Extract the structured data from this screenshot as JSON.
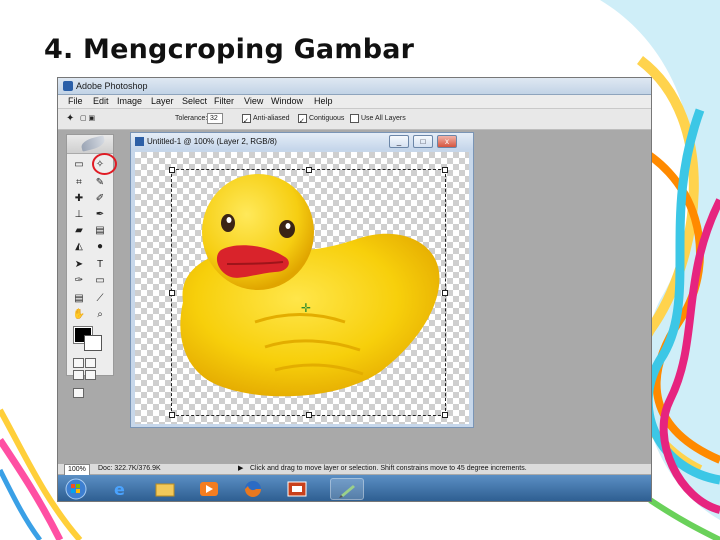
{
  "slide": {
    "title": "4. Mengcroping Gambar"
  },
  "window": {
    "app_title": "Adobe Photoshop"
  },
  "menu": [
    "File",
    "Edit",
    "Image",
    "Layer",
    "Select",
    "Filter",
    "View",
    "Window",
    "Help"
  ],
  "options_bar": {
    "tolerance_label": "Tolerance:",
    "tolerance_value": "32",
    "anti_aliased": "Anti-aliased",
    "contiguous": "Contiguous",
    "use_all_layers": "Use All Layers"
  },
  "document": {
    "title": "Untitled-1 @ 100% (Layer 2, RGB/8)",
    "buttons": [
      "_",
      "□",
      "x"
    ]
  },
  "status": {
    "zoom": "100%",
    "doc_size": "Doc: 322.7K/376.9K",
    "hint": "Click and drag to move layer or selection. Shift constrains move to 45 degree increments."
  },
  "icons": {
    "highlighted_tool": "magic-wand-icon",
    "highlight_color": "#e01b24"
  },
  "colors": {
    "duck_body": "#f7d10f",
    "duck_beak": "#d9232b",
    "taskbar": "#2b5b8e"
  }
}
